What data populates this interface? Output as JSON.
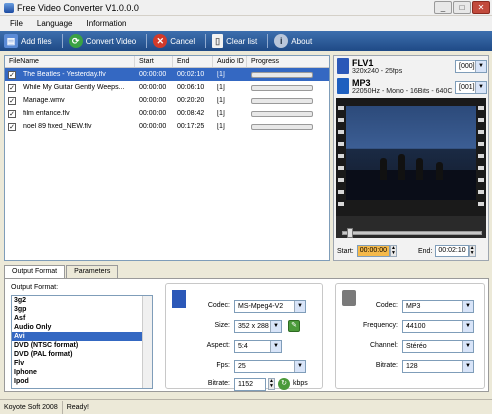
{
  "window": {
    "title": "Free Video Converter V1.0.0.0"
  },
  "menu": [
    "File",
    "Language",
    "Information"
  ],
  "toolbar": {
    "add_files": "Add files",
    "convert_video": "Convert Video",
    "cancel": "Cancel",
    "clear_list": "Clear list",
    "about": "About"
  },
  "file_table": {
    "columns": [
      "FileName",
      "Start",
      "End",
      "Audio ID",
      "Progress"
    ],
    "rows": [
      {
        "name": "The Beatles - Yesterday.flv",
        "start": "00:00:00",
        "end": "00:02:10",
        "audio": "[1]",
        "checked": "✓"
      },
      {
        "name": "While My Guitar Gently Weeps...",
        "start": "00:00:00",
        "end": "00:06:10",
        "audio": "[1]",
        "checked": "✓"
      },
      {
        "name": "Mariage.wmv",
        "start": "00:00:00",
        "end": "00:20:20",
        "audio": "[1]",
        "checked": "✓"
      },
      {
        "name": "film enfance.flv",
        "start": "00:00:00",
        "end": "00:08:42",
        "audio": "[1]",
        "checked": "✓"
      },
      {
        "name": "noel 89 fixed_NEW.flv",
        "start": "00:00:00",
        "end": "00:17:25",
        "audio": "[1]",
        "checked": "✓"
      }
    ]
  },
  "source_info": {
    "video_format": "FLV1",
    "video_details": "320x240 - 25fps",
    "video_stream": "[000]",
    "audio_format": "MP3",
    "audio_details": "22050Hz - Mono - 16Bits - 640C",
    "audio_stream": "[001]",
    "start_label": "Start:",
    "start_value": "00:00:00",
    "end_label": "End:",
    "end_value": "00:02:10"
  },
  "tabs": {
    "output_format": "Output Format",
    "parameters": "Parameters"
  },
  "output": {
    "label": "Output Format:",
    "formats": [
      "3g2",
      "3gp",
      "Asf",
      "Audio Only",
      "Avi",
      "DVD (NTSC format)",
      "DVD (PAL format)",
      "Flv",
      "Iphone",
      "Ipod"
    ],
    "selected_index": 4
  },
  "video_settings": {
    "codec_label": "Codec:",
    "codec": "MS-Mpeg4-V2",
    "size_label": "Size:",
    "size": "352 x 288",
    "aspect_label": "Aspect:",
    "aspect": "5:4",
    "fps_label": "Fps:",
    "fps": "25",
    "bitrate_label": "Bitrate:",
    "bitrate": "1152",
    "bitrate_unit": "kbps"
  },
  "audio_settings": {
    "codec_label": "Codec:",
    "codec": "MP3",
    "frequency_label": "Frequency:",
    "frequency": "44100",
    "channel_label": "Channel:",
    "channel": "Stéréo",
    "bitrate_label": "Bitrate:",
    "bitrate": "128"
  },
  "status": {
    "company": "Koyote Soft 2008",
    "message": "Ready!"
  }
}
